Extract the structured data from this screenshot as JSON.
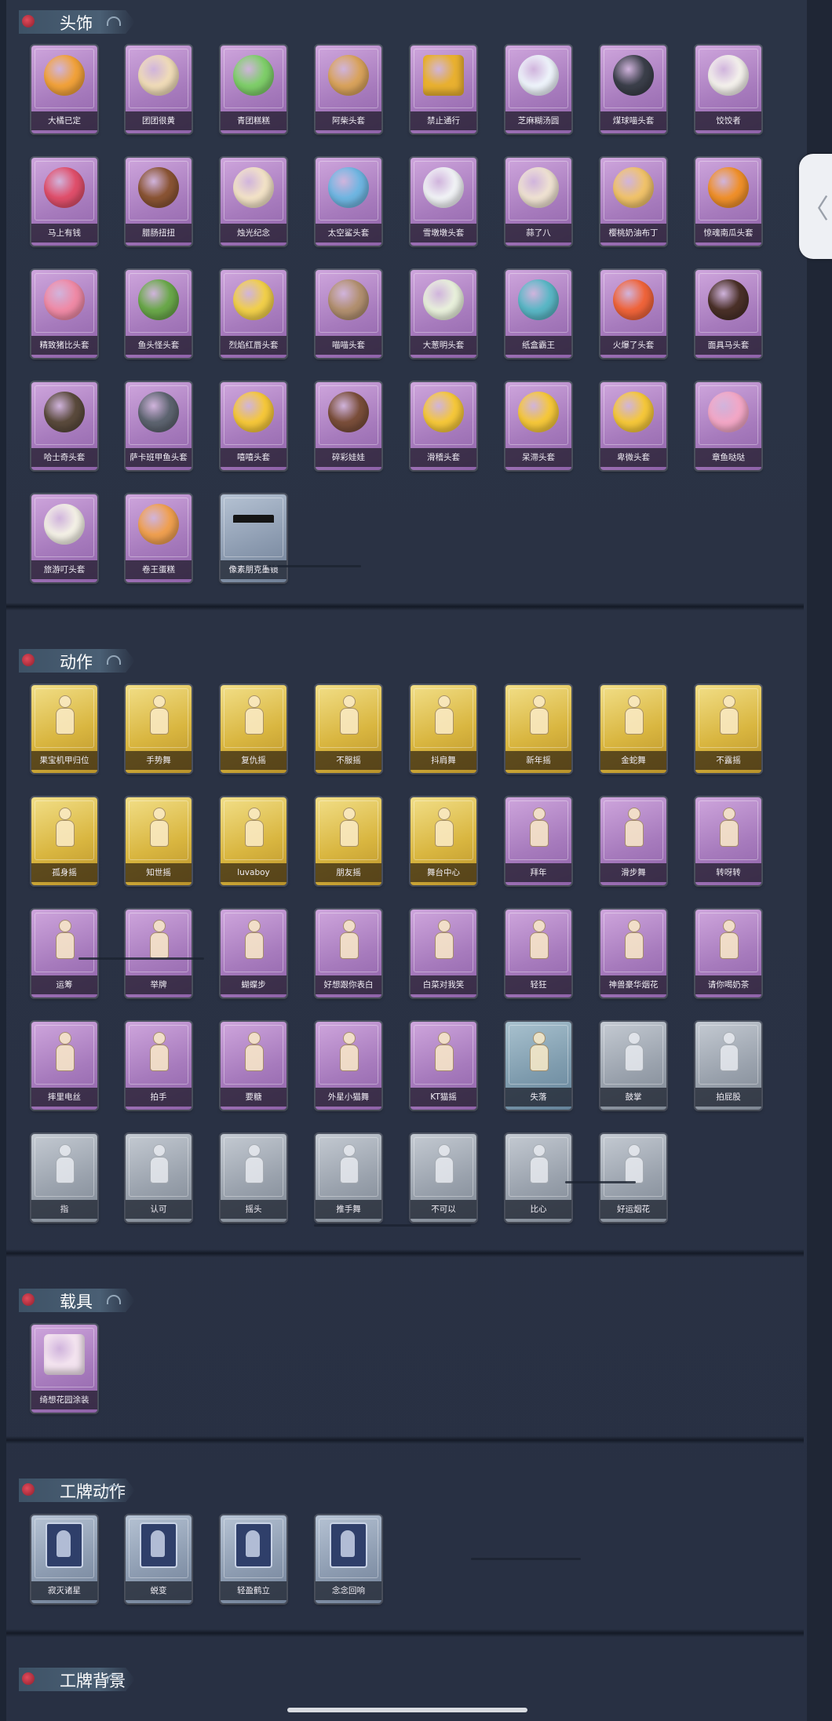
{
  "side_tab": {
    "icon": "chevron-left-icon",
    "glyph": "〈"
  },
  "sections": [
    {
      "title": "头饰",
      "items": [
        {
          "label": "大橘已定",
          "tier": "purple",
          "icon": "orange-head-icon",
          "color": "#f2a23a"
        },
        {
          "label": "团团很黄",
          "tier": "purple",
          "icon": "hamster-head-icon",
          "color": "#f0dcb8"
        },
        {
          "label": "青团糕糕",
          "tier": "purple",
          "icon": "green-dumpling-icon",
          "color": "#7fcf6a"
        },
        {
          "label": "阿柴头套",
          "tier": "purple",
          "icon": "shiba-head-icon",
          "color": "#d9a35c"
        },
        {
          "label": "禁止通行",
          "tier": "purple",
          "icon": "traffic-cone-icon",
          "color": "#e8b030"
        },
        {
          "label": "芝麻糊汤圆",
          "tier": "purple",
          "icon": "rice-ball-icon",
          "color": "#eef4fb"
        },
        {
          "label": "煤球喵头套",
          "tier": "purple",
          "icon": "black-cat-icon",
          "color": "#3b3f4a"
        },
        {
          "label": "饺饺者",
          "tier": "purple",
          "icon": "dumpling-icon",
          "color": "#f4f1ec"
        },
        {
          "label": "马上有钱",
          "tier": "purple",
          "icon": "horse-head-icon",
          "color": "#e04f6b"
        },
        {
          "label": "腊肠扭扭",
          "tier": "purple",
          "icon": "dachshund-icon",
          "color": "#8a5434"
        },
        {
          "label": "烛光纪念",
          "tier": "purple",
          "icon": "candle-icon",
          "color": "#f3e3c7"
        },
        {
          "label": "太空鲨头套",
          "tier": "purple",
          "icon": "shark-head-icon",
          "color": "#6fb6e2"
        },
        {
          "label": "雪墩墩头套",
          "tier": "purple",
          "icon": "snowman-head-icon",
          "color": "#f1f3f6"
        },
        {
          "label": "蒜了八",
          "tier": "purple",
          "icon": "garlic-icon",
          "color": "#efe2d2"
        },
        {
          "label": "樱桃奶油布丁",
          "tier": "purple",
          "icon": "pudding-icon",
          "color": "#f1c36a"
        },
        {
          "label": "惊魂南瓜头套",
          "tier": "purple",
          "icon": "pumpkin-icon",
          "color": "#f0902a"
        },
        {
          "label": "精致猪比头套",
          "tier": "purple",
          "icon": "pig-head-icon",
          "color": "#f08aa6"
        },
        {
          "label": "鱼头怪头套",
          "tier": "purple",
          "icon": "fish-head-icon",
          "color": "#6aa84a"
        },
        {
          "label": "烈焰红唇头套",
          "tier": "purple",
          "icon": "duck-head-icon",
          "color": "#f2d04a"
        },
        {
          "label": "喵喵头套",
          "tier": "purple",
          "icon": "tabby-cat-icon",
          "color": "#b29070"
        },
        {
          "label": "大葱明头套",
          "tier": "purple",
          "icon": "scallion-icon",
          "color": "#e9f1dc"
        },
        {
          "label": "纸盒霸王",
          "tier": "purple",
          "icon": "dino-box-icon",
          "color": "#5ab7c6"
        },
        {
          "label": "火爆了头套",
          "tier": "purple",
          "icon": "fire-head-icon",
          "color": "#f0643a"
        },
        {
          "label": "面具马头套",
          "tier": "purple",
          "icon": "horse-mask-icon",
          "color": "#4a3028"
        },
        {
          "label": "哈士奇头套",
          "tier": "purple",
          "icon": "husky-head-icon",
          "color": "#5a4a3c"
        },
        {
          "label": "萨卡班甲鱼头套",
          "tier": "purple",
          "icon": "fish-blob-icon",
          "color": "#5d6470"
        },
        {
          "label": "嘻嘻头套",
          "tier": "purple",
          "icon": "grin-emoji-icon",
          "color": "#f6c83a"
        },
        {
          "label": "碎彩娃娃",
          "tier": "purple",
          "icon": "doll-head-icon",
          "color": "#7a4e3a"
        },
        {
          "label": "滑稽头套",
          "tier": "purple",
          "icon": "smirk-emoji-icon",
          "color": "#f6c83a"
        },
        {
          "label": "呆滞头套",
          "tier": "purple",
          "icon": "dazed-emoji-icon",
          "color": "#f6c83a"
        },
        {
          "label": "卑微头套",
          "tier": "purple",
          "icon": "sad-emoji-icon",
          "color": "#f6c83a"
        },
        {
          "label": "章鱼哒哒",
          "tier": "purple",
          "icon": "octopus-icon",
          "color": "#f3a7c6"
        },
        {
          "label": "旅游叮头套",
          "tier": "purple",
          "icon": "bird-hat-icon",
          "color": "#f4f1e6"
        },
        {
          "label": "卷王蛋糕",
          "tier": "purple",
          "icon": "roll-cake-icon",
          "color": "#f0a050"
        },
        {
          "label": "像素朋克墨镜",
          "tier": "blue",
          "icon": "pixel-sunglasses-icon",
          "color": "#1a1a1a"
        }
      ]
    },
    {
      "title": "动作",
      "items": [
        {
          "label": "果宝机甲归位",
          "tier": "gold",
          "icon": "pose-icon"
        },
        {
          "label": "手势舞",
          "tier": "gold",
          "icon": "pose-icon"
        },
        {
          "label": "复仇摇",
          "tier": "gold",
          "icon": "pose-icon"
        },
        {
          "label": "不服摇",
          "tier": "gold",
          "icon": "pose-icon"
        },
        {
          "label": "抖肩舞",
          "tier": "gold",
          "icon": "pose-icon"
        },
        {
          "label": "新年摇",
          "tier": "gold",
          "icon": "pose-icon"
        },
        {
          "label": "金蛇舞",
          "tier": "gold",
          "icon": "pose-icon"
        },
        {
          "label": "不露摇",
          "tier": "gold",
          "icon": "pose-icon"
        },
        {
          "label": "孤身摇",
          "tier": "gold",
          "icon": "pose-icon"
        },
        {
          "label": "知世摇",
          "tier": "gold",
          "icon": "pose-icon"
        },
        {
          "label": "luvaboy",
          "tier": "gold",
          "icon": "pose-icon"
        },
        {
          "label": "朋友摇",
          "tier": "gold",
          "icon": "pose-icon"
        },
        {
          "label": "舞台中心",
          "tier": "gold",
          "icon": "pose-icon"
        },
        {
          "label": "拜年",
          "tier": "purple",
          "icon": "pose-icon"
        },
        {
          "label": "滑步舞",
          "tier": "purple",
          "icon": "pose-icon"
        },
        {
          "label": "转呀转",
          "tier": "purple",
          "icon": "pose-icon"
        },
        {
          "label": "运筹",
          "tier": "purple",
          "icon": "pose-icon"
        },
        {
          "label": "举牌",
          "tier": "purple",
          "icon": "pose-icon"
        },
        {
          "label": "蝴蝶步",
          "tier": "purple",
          "icon": "pose-icon"
        },
        {
          "label": "好想跟你表白",
          "tier": "purple",
          "icon": "pose-icon"
        },
        {
          "label": "白菜对我笑",
          "tier": "purple",
          "icon": "pose-icon"
        },
        {
          "label": "轻狂",
          "tier": "purple",
          "icon": "pose-icon"
        },
        {
          "label": "神兽豪华烟花",
          "tier": "purple",
          "icon": "firework-icon"
        },
        {
          "label": "请你喝奶茶",
          "tier": "purple",
          "icon": "pose-icon"
        },
        {
          "label": "摔里电丝",
          "tier": "purple",
          "icon": "pose-icon"
        },
        {
          "label": "拍手",
          "tier": "purple",
          "icon": "pose-icon"
        },
        {
          "label": "要糖",
          "tier": "purple",
          "icon": "pose-icon"
        },
        {
          "label": "外星小猫舞",
          "tier": "purple",
          "icon": "pose-icon"
        },
        {
          "label": "KT猫摇",
          "tier": "purple",
          "icon": "pose-icon"
        },
        {
          "label": "失落",
          "tier": "teal",
          "icon": "pose-icon"
        },
        {
          "label": "鼓掌",
          "tier": "gray",
          "icon": "pose-icon"
        },
        {
          "label": "拍屁股",
          "tier": "gray",
          "icon": "pose-icon"
        },
        {
          "label": "指",
          "tier": "gray",
          "icon": "pose-icon"
        },
        {
          "label": "认可",
          "tier": "gray",
          "icon": "pose-icon"
        },
        {
          "label": "摇头",
          "tier": "gray",
          "icon": "pose-icon"
        },
        {
          "label": "推手舞",
          "tier": "gray",
          "icon": "pose-icon"
        },
        {
          "label": "不可以",
          "tier": "gray",
          "icon": "pose-icon"
        },
        {
          "label": "比心",
          "tier": "gray",
          "icon": "pose-icon"
        },
        {
          "label": "好运烟花",
          "tier": "gray",
          "icon": "firework-icon"
        }
      ]
    },
    {
      "title": "载具",
      "items": [
        {
          "label": "绮想花园涂装",
          "tier": "purple",
          "icon": "ice-cream-truck-icon",
          "color": "#f3e3ef"
        }
      ]
    },
    {
      "title": "工牌动作",
      "items": [
        {
          "label": "寂灭诸星",
          "tier": "blue",
          "icon": "badge-card-icon"
        },
        {
          "label": "蜕变",
          "tier": "blue",
          "icon": "badge-card-icon"
        },
        {
          "label": "轻盈鹤立",
          "tier": "blue",
          "icon": "badge-card-icon"
        },
        {
          "label": "念念回响",
          "tier": "blue",
          "icon": "badge-card-icon"
        }
      ]
    },
    {
      "title": "工牌背景",
      "items": []
    }
  ]
}
